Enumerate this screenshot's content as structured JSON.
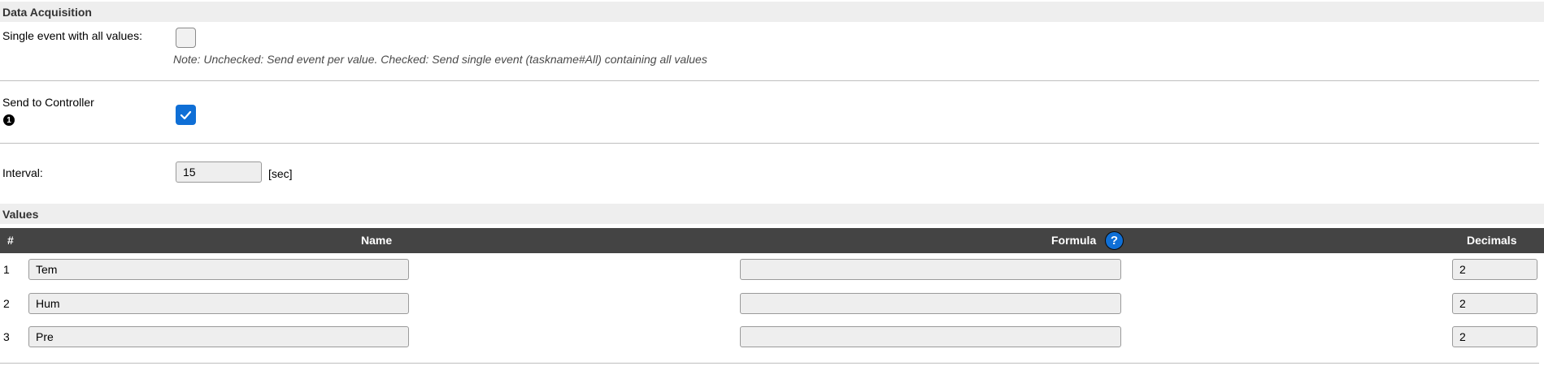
{
  "data_acquisition": {
    "header": "Data Acquisition",
    "single_event_label": "Single event with all values:",
    "single_event_checked": false,
    "single_event_note": "Note: Unchecked: Send event per value. Checked: Send single event (taskname#All) containing all values",
    "send_to_controller_label": "Send to Controller",
    "send_to_controller_badge": "1",
    "send_to_controller_checked": true,
    "interval_label": "Interval:",
    "interval_value": "15",
    "interval_unit": "[sec]"
  },
  "values": {
    "header": "Values",
    "columns": {
      "index": "#",
      "name": "Name",
      "formula": "Formula",
      "formula_help": "?",
      "decimals": "Decimals"
    },
    "rows": [
      {
        "index": "1",
        "name": "Tem",
        "formula": "",
        "decimals": "2"
      },
      {
        "index": "2",
        "name": "Hum",
        "formula": "",
        "decimals": "2"
      },
      {
        "index": "3",
        "name": "Pre",
        "formula": "",
        "decimals": "2"
      }
    ]
  },
  "colors": {
    "accent": "#0f6fd6",
    "table_header": "#444444",
    "section_header": "#eeeeee"
  }
}
